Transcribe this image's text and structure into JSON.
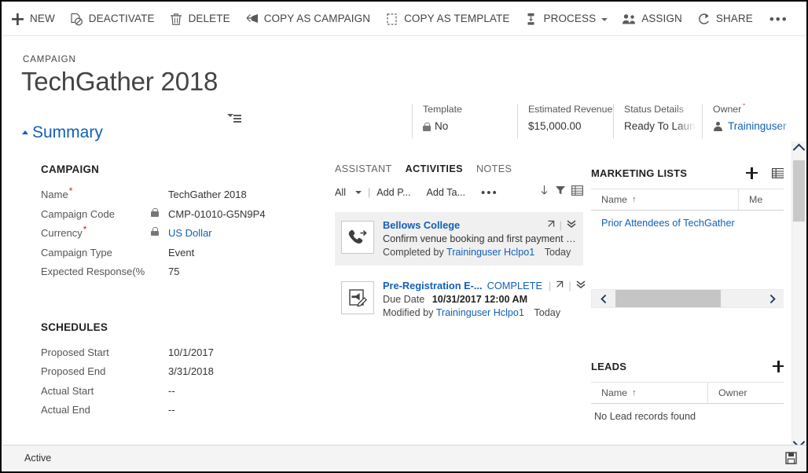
{
  "command_bar": {
    "items": [
      {
        "label": "NEW",
        "icon": "plus-icon",
        "has_caret": false
      },
      {
        "label": "DEACTIVATE",
        "icon": "deactivate-icon",
        "has_caret": false
      },
      {
        "label": "DELETE",
        "icon": "trash-icon",
        "has_caret": false
      },
      {
        "label": "COPY AS CAMPAIGN",
        "icon": "copy-campaign-icon",
        "has_caret": false
      },
      {
        "label": "COPY AS TEMPLATE",
        "icon": "copy-template-icon",
        "has_caret": false
      },
      {
        "label": "PROCESS",
        "icon": "process-icon",
        "has_caret": true
      },
      {
        "label": "ASSIGN",
        "icon": "assign-icon",
        "has_caret": false
      },
      {
        "label": "SHARE",
        "icon": "share-icon",
        "has_caret": false
      }
    ],
    "overflow_label": "•••",
    "right_buttons": [
      {
        "name": "previous-record-button",
        "icon": "arrow-up-icon"
      },
      {
        "name": "next-record-button",
        "icon": "arrow-down-icon"
      },
      {
        "name": "popout-button",
        "icon": "popout-icon"
      },
      {
        "name": "close-button",
        "icon": "close-icon"
      }
    ]
  },
  "record_header": {
    "entity_label": "CAMPAIGN",
    "title": "TechGather 2018",
    "fields": [
      {
        "label": "Template",
        "value": "No",
        "required": false,
        "locked": true,
        "link": false
      },
      {
        "label": "Estimated Revenue",
        "value": "$15,000.00",
        "required": false,
        "locked": false,
        "link": false
      },
      {
        "label": "Status Details",
        "value": "Ready To Launch",
        "required": false,
        "locked": false,
        "link": false
      },
      {
        "label": "Owner",
        "value": "Traininguser",
        "required": true,
        "locked": false,
        "link": true,
        "person": true
      }
    ]
  },
  "summary_tab": {
    "label": "Summary"
  },
  "campaign_section": {
    "title": "CAMPAIGN",
    "fields": [
      {
        "label": "Name",
        "required": true,
        "locked": false,
        "value": "TechGather 2018",
        "link": false
      },
      {
        "label": "Campaign Code",
        "required": false,
        "locked": true,
        "value": "CMP-01010-G5N9P4",
        "link": false
      },
      {
        "label": "Currency",
        "required": true,
        "locked": true,
        "value": "US Dollar",
        "link": true
      },
      {
        "label": "Campaign Type",
        "required": false,
        "locked": false,
        "value": "Event",
        "link": false
      },
      {
        "label": "Expected Response(%",
        "required": false,
        "locked": false,
        "value": "75",
        "link": false
      }
    ]
  },
  "schedules_section": {
    "title": "SCHEDULES",
    "fields": [
      {
        "label": "Proposed Start",
        "value": "10/1/2017"
      },
      {
        "label": "Proposed End",
        "value": "3/31/2018"
      },
      {
        "label": "Actual Start",
        "value": "--"
      },
      {
        "label": "Actual End",
        "value": "--"
      }
    ]
  },
  "activities_panel": {
    "tabs": [
      {
        "label": "ASSISTANT",
        "active": false
      },
      {
        "label": "ACTIVITIES",
        "active": true
      },
      {
        "label": "NOTES",
        "active": false
      }
    ],
    "toolbar": {
      "filter_value": "All",
      "separator": "|",
      "add_phone_label": "Add P...",
      "add_task_label": "Add Ta...",
      "overflow_label": "•••",
      "sort_icon": "sort-down-icon",
      "filter_icon": "funnel-icon",
      "view_icon": "grid-view-icon"
    },
    "cards": [
      {
        "icon": "phone-outgoing-icon",
        "selected": true,
        "subject": "Bellows College",
        "status": "",
        "line2_label": "",
        "line2_value": "Confirm venue booking and first payment for...",
        "line3_prefix": "Completed by",
        "line3_who": "Traininguser Hclpo1",
        "line3_when": "Today",
        "popout_icon": "popout-icon",
        "chevron_icon": "chevron-double-down-icon"
      },
      {
        "icon": "campaign-activity-icon",
        "selected": false,
        "subject": "Pre-Registration E-...",
        "status": "COMPLETE",
        "line2_label": "Due Date",
        "line2_value": "10/31/2017 12:00 AM",
        "line3_prefix": "Modified by",
        "line3_who": "Traininguser Hclpo1",
        "line3_when": "Today",
        "popout_icon": "popout-icon",
        "chevron_icon": "chevron-double-down-icon"
      }
    ]
  },
  "marketing_lists_panel": {
    "title": "MARKETING LISTS",
    "add_icon": "plus-icon",
    "view_icon": "grid-view-icon",
    "columns": [
      {
        "label": "Name",
        "sort": "↑"
      },
      {
        "label": "Me",
        "sort": ""
      }
    ],
    "rows": [
      {
        "name": "Prior Attendees of TechGather"
      }
    ],
    "scroll_left_icon": "chevron-left-icon",
    "scroll_right_icon": "chevron-right-icon"
  },
  "leads_panel": {
    "title": "LEADS",
    "add_icon": "plus-icon",
    "columns": [
      {
        "label": "Name",
        "sort": "↑"
      },
      {
        "label": "Owner",
        "sort": ""
      }
    ],
    "empty_message": "No Lead records found"
  },
  "status_bar": {
    "status": "Active",
    "save_icon": "save-icon"
  },
  "colors": {
    "link": "#1160b7",
    "required_star": "#c0271e",
    "text": "#333333",
    "label": "#555555",
    "selected_card_bg": "#f0f0f0",
    "scrollbar_thumb": "#c9c9c9",
    "statusbar_bg": "#f4f4f4"
  }
}
